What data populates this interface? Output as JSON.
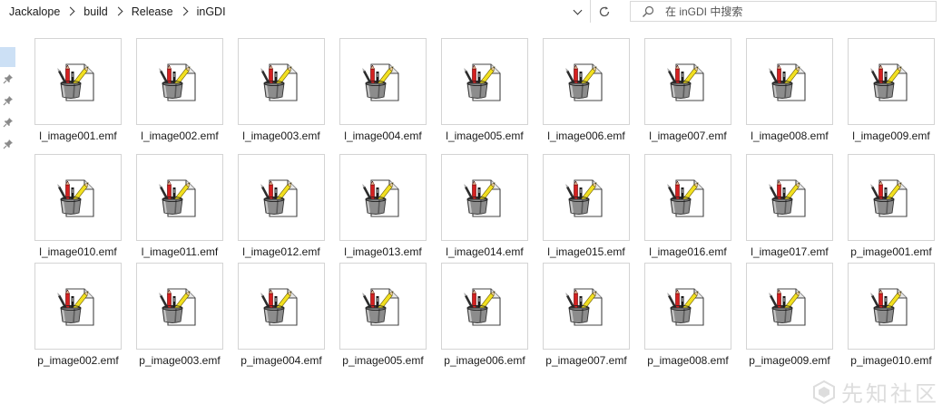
{
  "address_bar": {
    "crumbs": [
      "Jackalope",
      "build",
      "Release",
      "inGDI"
    ]
  },
  "search": {
    "placeholder": "在 inGDI 中搜索"
  },
  "files": [
    "l_image001.emf",
    "l_image002.emf",
    "l_image003.emf",
    "l_image004.emf",
    "l_image005.emf",
    "l_image006.emf",
    "l_image007.emf",
    "l_image008.emf",
    "l_image009.emf",
    "l_image010.emf",
    "l_image011.emf",
    "l_image012.emf",
    "l_image013.emf",
    "l_image014.emf",
    "l_image015.emf",
    "l_image016.emf",
    "l_image017.emf",
    "p_image001.emf",
    "p_image002.emf",
    "p_image003.emf",
    "p_image004.emf",
    "p_image005.emf",
    "p_image006.emf",
    "p_image007.emf",
    "p_image008.emf",
    "p_image009.emf",
    "p_image010.emf"
  ],
  "file_icon": "emf-drawing-file-icon",
  "watermark": {
    "text": "先知社区"
  },
  "colors": {
    "nav_selection": "#cce0f5",
    "border": "#d4d4d4"
  }
}
